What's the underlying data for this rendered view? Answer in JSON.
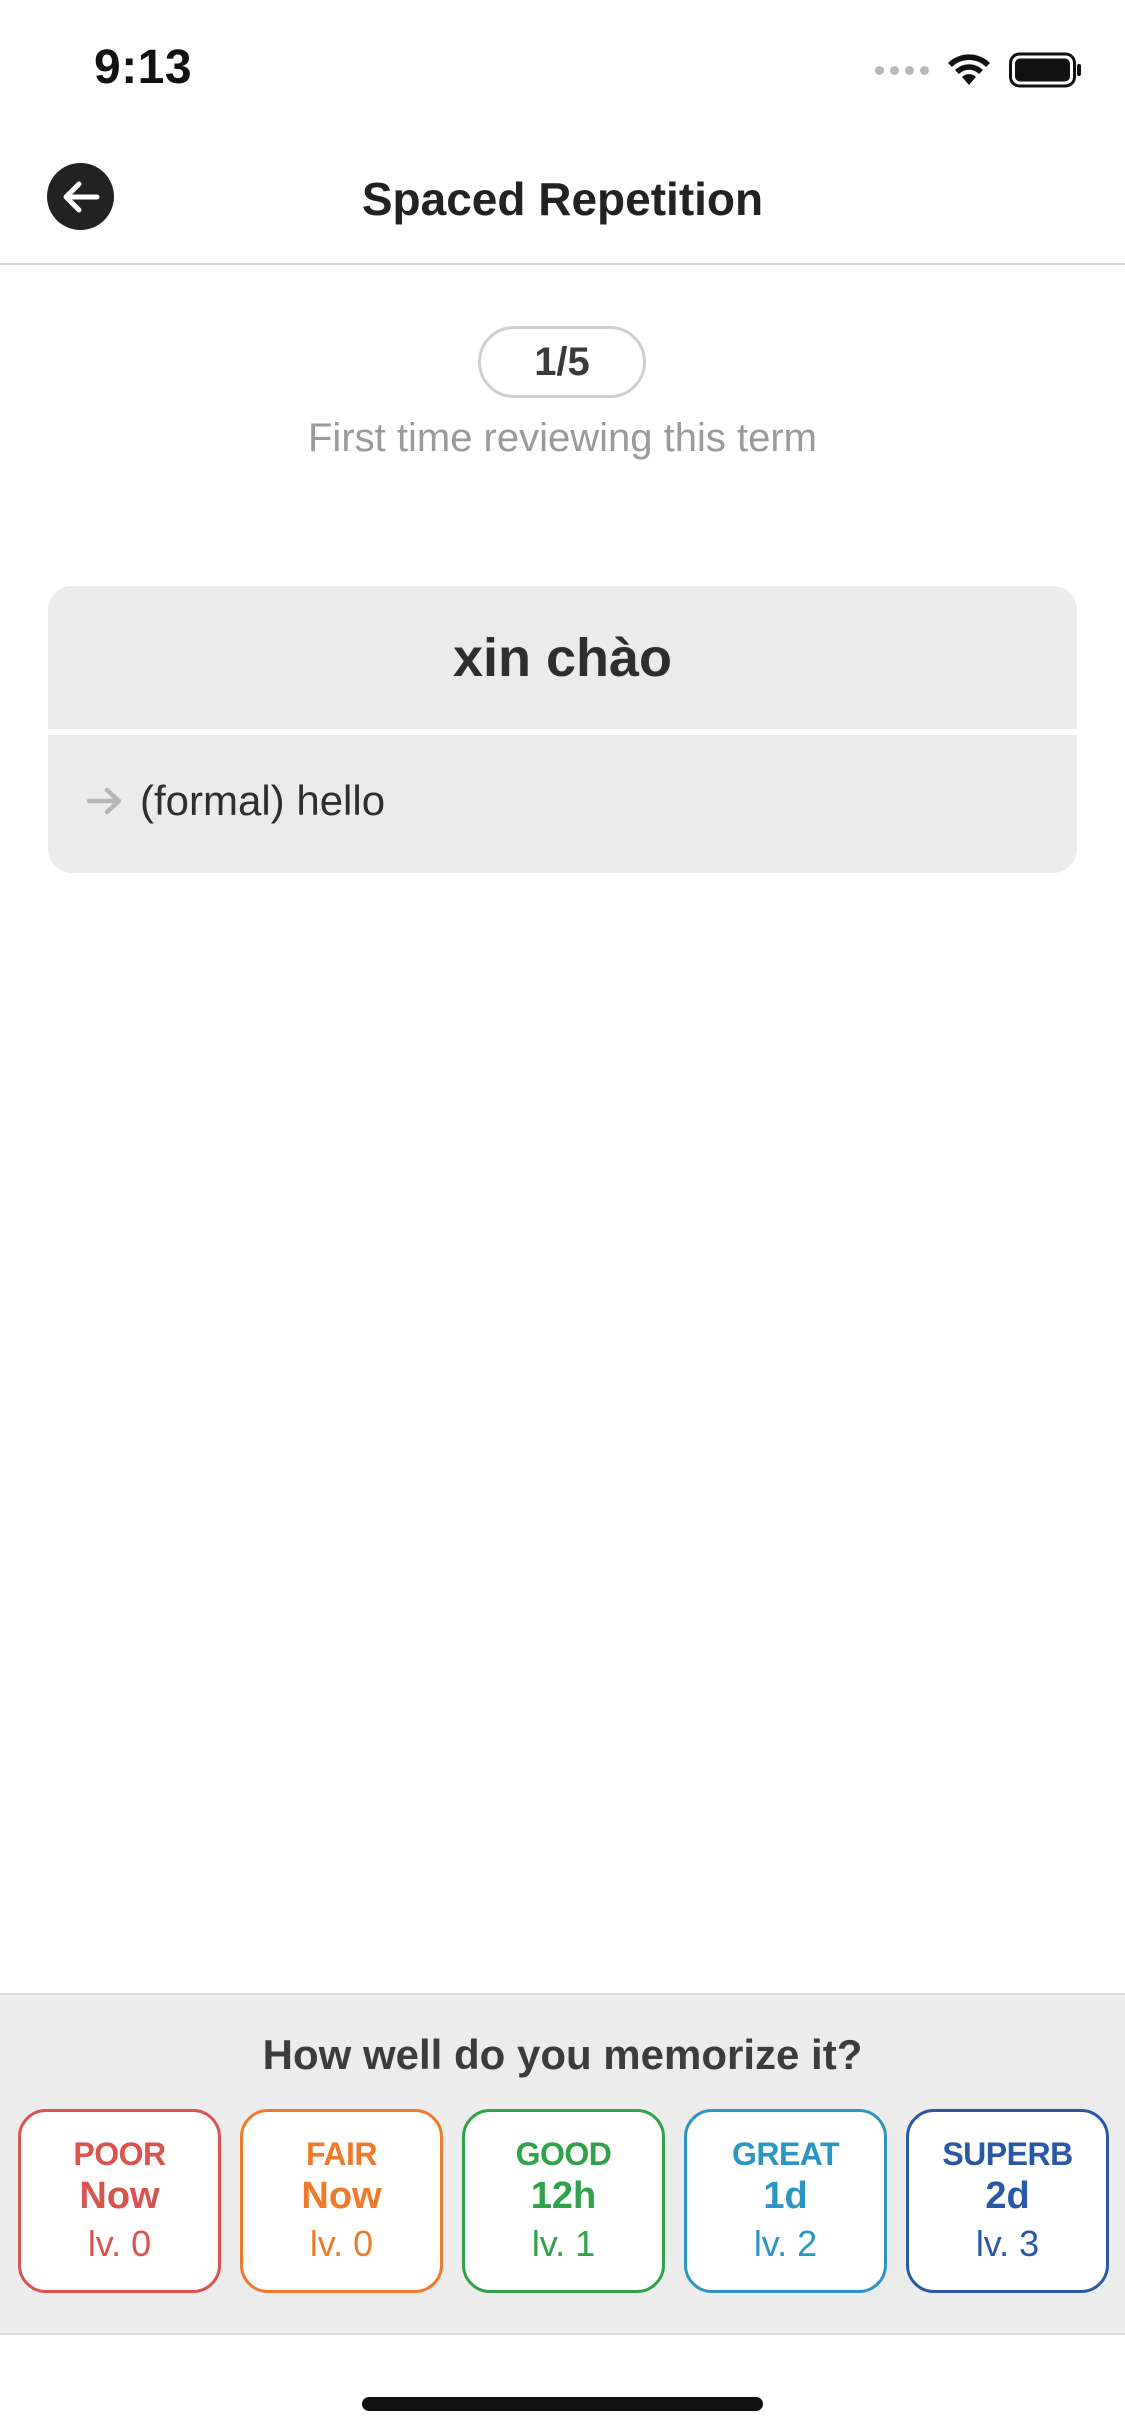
{
  "status_bar": {
    "time": "9:13"
  },
  "nav": {
    "title": "Spaced Repetition",
    "back_icon": "arrow-left-icon"
  },
  "progress": {
    "counter": "1/5",
    "caption": "First time reviewing this term"
  },
  "card": {
    "term": "xin chào",
    "definition": "(formal) hello"
  },
  "rating": {
    "question": "How well do you memorize it?",
    "options": [
      {
        "label": "POOR",
        "interval": "Now",
        "level": "lv. 0",
        "color": "#d9534f"
      },
      {
        "label": "FAIR",
        "interval": "Now",
        "level": "lv. 0",
        "color": "#f07a2b"
      },
      {
        "label": "GOOD",
        "interval": "12h",
        "level": "lv. 1",
        "color": "#2fa24a"
      },
      {
        "label": "GREAT",
        "interval": "1d",
        "level": "lv. 2",
        "color": "#2b95c4"
      },
      {
        "label": "SUPERB",
        "interval": "2d",
        "level": "lv. 3",
        "color": "#2a57a6"
      }
    ]
  }
}
